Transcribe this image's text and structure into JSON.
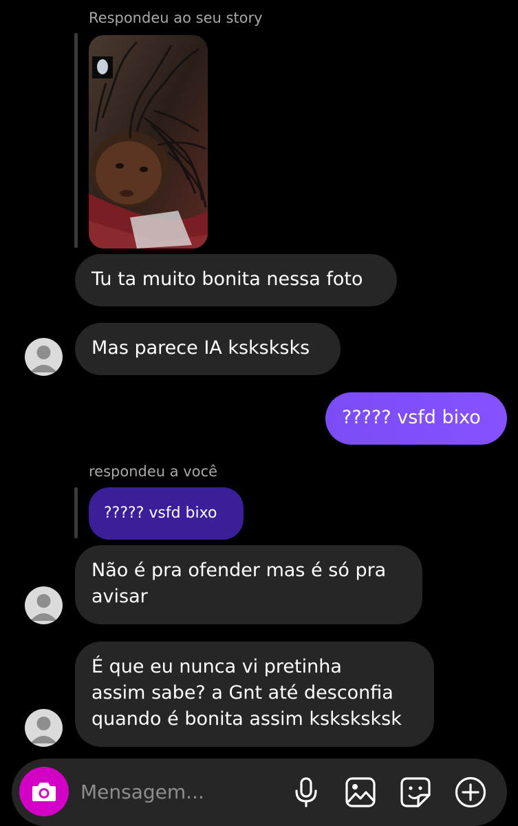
{
  "thread": {
    "story_reply_caption": "Respondeu ao seu story",
    "message_reply_caption": "respondeu a você"
  },
  "messages": {
    "m1": {
      "text": "Tu ta muito bonita nessa foto"
    },
    "m2": {
      "text": "Mas parece IA ksksksks"
    },
    "m3": {
      "text": "????? vsfd bixo"
    },
    "quoted": {
      "text": "????? vsfd bixo"
    },
    "m4": {
      "lines": [
        "Não é pra ofender mas é só pra",
        "avisar"
      ]
    },
    "m5": {
      "lines": [
        "É que eu nunca vi pretinha",
        "assim sabe? a Gnt até desconfia",
        "quando é bonita assim ksksksksk"
      ]
    }
  },
  "composer": {
    "placeholder": "Mensagem...",
    "icons": [
      "camera-icon",
      "microphone-icon",
      "gallery-icon",
      "sticker-icon",
      "plus-icon"
    ]
  },
  "colors": {
    "background": "#000000",
    "received_bubble": "#262626",
    "sent_bubble": "#7c4dff",
    "quoted_bubble": "#3b1f9a",
    "camera_button": "#d300c5"
  }
}
